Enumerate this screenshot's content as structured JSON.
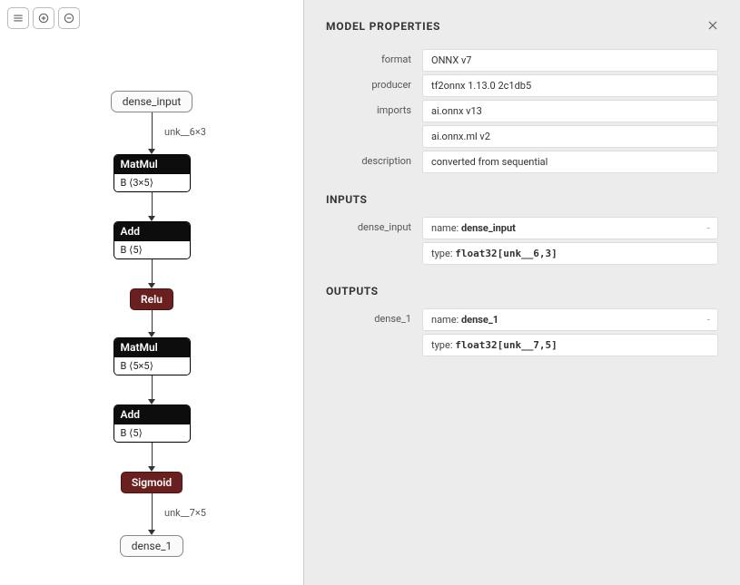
{
  "toolbar": {
    "menu_title": "Menu",
    "zoom_in_title": "Zoom In",
    "zoom_out_title": "Zoom Out"
  },
  "graph": {
    "input_node": "dense_input",
    "edge1_label": "unk__6×3",
    "op1": {
      "name": "MatMul",
      "attr": "B ⟨3×5⟩"
    },
    "op2": {
      "name": "Add",
      "attr": "B ⟨5⟩"
    },
    "act1": "Relu",
    "op3": {
      "name": "MatMul",
      "attr": "B ⟨5×5⟩"
    },
    "op4": {
      "name": "Add",
      "attr": "B ⟨5⟩"
    },
    "act2": "Sigmoid",
    "edge2_label": "unk__7×5",
    "output_node": "dense_1"
  },
  "panel": {
    "title": "MODEL PROPERTIES",
    "sections": {
      "inputs": "INPUTS",
      "outputs": "OUTPUTS"
    },
    "labels": {
      "format": "format",
      "producer": "producer",
      "imports": "imports",
      "description": "description",
      "dense_input": "dense_input",
      "dense_1": "dense_1",
      "name_key": "name:",
      "type_key": "type:"
    },
    "values": {
      "format": "ONNX v7",
      "producer": "tf2onnx 1.13.0 2c1db5",
      "imports": [
        "ai.onnx v13",
        "ai.onnx.ml v2"
      ],
      "description": "converted from sequential",
      "input_name": "dense_input",
      "input_type": "float32[unk__6,3]",
      "output_name": "dense_1",
      "output_type": "float32[unk__7,5]"
    }
  }
}
